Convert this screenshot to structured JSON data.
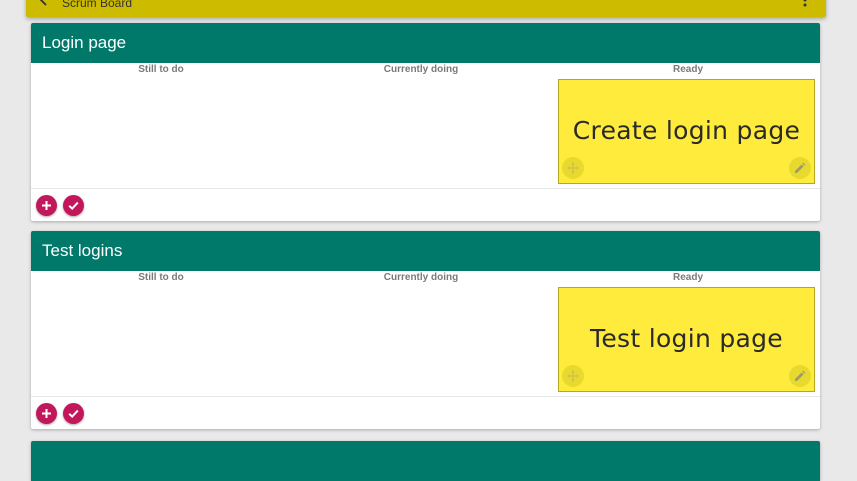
{
  "appbar": {
    "title": "Scrum Board"
  },
  "cards": [
    {
      "title": "Login page",
      "columns": [
        "Still to do",
        "Currently doing",
        "Ready"
      ],
      "note": "Create login page"
    },
    {
      "title": "Test logins",
      "columns": [
        "Still to do",
        "Currently doing",
        "Ready"
      ],
      "note": "Test login page"
    },
    {
      "title": ""
    }
  ],
  "colors": {
    "appbar": "#cdbb00",
    "card_header": "#00796b",
    "note": "#ffeb3b",
    "fab": "#c2185b"
  }
}
